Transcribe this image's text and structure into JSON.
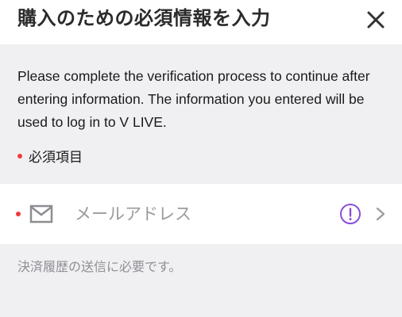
{
  "header": {
    "title": "購入のための必須情報を入力",
    "close_icon": "close-icon"
  },
  "intro": {
    "text": "Please complete the verification process to continue after entering information. The information you entered will be used to log in to V LIVE."
  },
  "required_legend": {
    "label": "必須項目",
    "marker_color": "#ef3b3b"
  },
  "email_field": {
    "icon": "mail-icon",
    "placeholder": "メールアドレス",
    "status_icon": "info-icon",
    "status_color": "#8a4fd8",
    "action_icon": "chevron-right-icon"
  },
  "footer": {
    "note": "決済履歴の送信に必要です。"
  }
}
